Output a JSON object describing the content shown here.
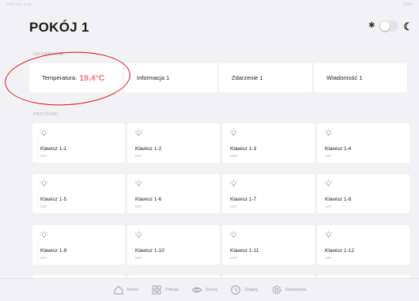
{
  "page": {
    "title": "POKÓJ 1"
  },
  "status_bar": {
    "left": "9:41  Sob 1 sty",
    "right": "100%"
  },
  "sections": {
    "info": "INFORMACJE",
    "buttons": "PRZYCISKI"
  },
  "info_cards": [
    {
      "label": "Temperatura:",
      "value": "19.4°C"
    },
    {
      "label": "Informacja 1"
    },
    {
      "label": "Zdarzenie 1"
    },
    {
      "label": "Wiadomość 1"
    }
  ],
  "buttons": [
    {
      "label": "Klawisz 1-1",
      "state": "OFF"
    },
    {
      "label": "Klawisz 1-2",
      "state": "OFF"
    },
    {
      "label": "Klawisz 1-3",
      "state": "OFF"
    },
    {
      "label": "Klawisz 1-4",
      "state": "OFF"
    },
    {
      "label": "Klawisz 1-5",
      "state": "OFF"
    },
    {
      "label": "Klawisz 1-6",
      "state": "OFF"
    },
    {
      "label": "Klawisz 1-7",
      "state": "OFF"
    },
    {
      "label": "Klawisz 1-8",
      "state": "OFF"
    },
    {
      "label": "Klawisz 1-9",
      "state": "OFF"
    },
    {
      "label": "Klawisz 1-10",
      "state": "OFF"
    },
    {
      "label": "Klawisz 1-11",
      "state": "OFF"
    },
    {
      "label": "Klawisz 1-12",
      "state": "OFF"
    }
  ],
  "tab_bar": [
    {
      "label": "Home",
      "icon": "home-icon"
    },
    {
      "label": "Pokoje",
      "icon": "grid-icon"
    },
    {
      "label": "Sceny",
      "icon": "eye-icon"
    },
    {
      "label": "Zegary",
      "icon": "clock-icon"
    },
    {
      "label": "Ustawienia",
      "icon": "gear-icon"
    }
  ],
  "colors": {
    "accent_temperature": "#f07080",
    "annotation": "#d41020",
    "background": "#f2f2f4"
  }
}
